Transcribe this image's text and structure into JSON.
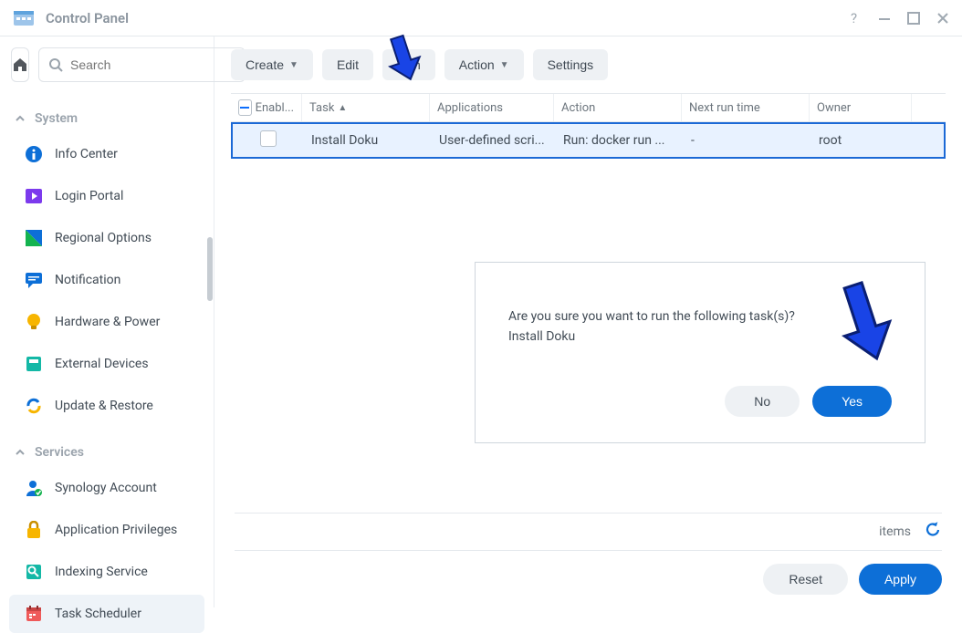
{
  "window": {
    "title": "Control Panel"
  },
  "search": {
    "placeholder": "Search"
  },
  "sidebar": {
    "section1": {
      "label": "System"
    },
    "items1": [
      {
        "label": "Info Center"
      },
      {
        "label": "Login Portal"
      },
      {
        "label": "Regional Options"
      },
      {
        "label": "Notification"
      },
      {
        "label": "Hardware & Power"
      },
      {
        "label": "External Devices"
      },
      {
        "label": "Update & Restore"
      }
    ],
    "section2": {
      "label": "Services"
    },
    "items2": [
      {
        "label": "Synology Account"
      },
      {
        "label": "Application Privileges"
      },
      {
        "label": "Indexing Service"
      },
      {
        "label": "Task Scheduler"
      }
    ]
  },
  "toolbar": {
    "create": "Create",
    "edit": "Edit",
    "run": "Run",
    "action": "Action",
    "settings": "Settings"
  },
  "table": {
    "headers": {
      "enabled": "Enabl...",
      "task": "Task",
      "applications": "Applications",
      "action": "Action",
      "next": "Next run time",
      "owner": "Owner"
    },
    "row": {
      "task": "Install Doku",
      "applications": "User-defined scri...",
      "action": "Run: docker run ...",
      "next": "-",
      "owner": "root"
    }
  },
  "dialog": {
    "line1": "Are you sure you want to run the following task(s)?",
    "line2": "Install Doku",
    "no": "No",
    "yes": "Yes"
  },
  "footer": {
    "items": "items",
    "reset": "Reset",
    "apply": "Apply"
  }
}
